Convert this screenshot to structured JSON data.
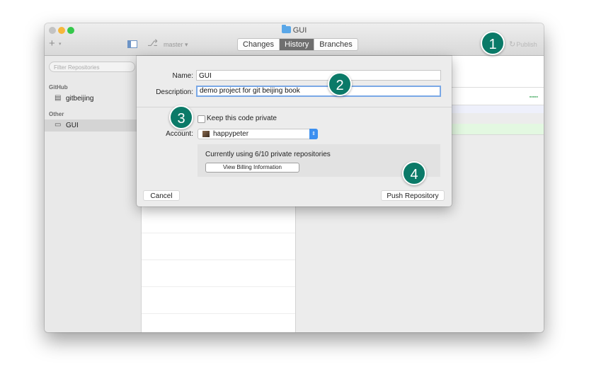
{
  "window": {
    "title": "GUI",
    "tabs": [
      {
        "label": "Changes",
        "active": false
      },
      {
        "label": "History",
        "active": true
      },
      {
        "label": "Branches",
        "active": false
      }
    ],
    "branch": "master ▾",
    "publish_label": "Publish",
    "add_symbol": "+",
    "add_caret": "▾",
    "icons": {
      "folder": "folder-icon",
      "refresh": "refresh-icon",
      "branch": "branch-icon",
      "sidebar_toggle": "sidebar-toggle-icon"
    }
  },
  "sidebar": {
    "filter_placeholder": "Filter Repositories",
    "sections": [
      {
        "title": "GitHub",
        "items": [
          {
            "label": "gitbeijing",
            "icon": "repo-icon",
            "selected": false
          }
        ]
      },
      {
        "title": "Other",
        "items": [
          {
            "label": "GUI",
            "icon": "computer-icon",
            "selected": true
          }
        ]
      }
    ]
  },
  "dialog": {
    "name_label": "Name:",
    "name_value": "GUI",
    "description_label": "Description:",
    "description_value": "demo project for git beijing book",
    "private_label": "Keep this code private",
    "private_checked": false,
    "account_label": "Account:",
    "account_value": "happypeter",
    "billing_text": "Currently using 6/10 private repositories",
    "billing_button": "View Billing Information",
    "cancel_button": "Cancel",
    "push_button": "Push Repository"
  },
  "callouts": [
    "1",
    "2",
    "3",
    "4"
  ],
  "colors": {
    "callout": "#0b7a68",
    "active_tab": "#6f6f6f",
    "focus_ring": "#7aa8e6",
    "select_accent": "#3b8ff0",
    "diff_added": "#e3f8e1"
  }
}
